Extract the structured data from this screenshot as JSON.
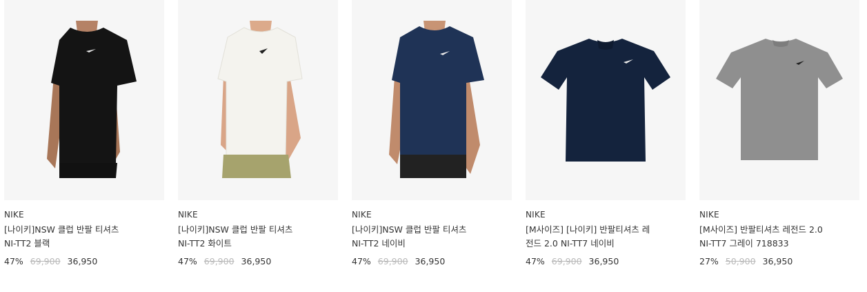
{
  "products": [
    {
      "brand": "NIKE",
      "title_line1": "[나이키]NSW 클럽 반팔 티셔츠",
      "title_line2": "NI-TT2 블랙",
      "discount": "47%",
      "original_price": "69,900",
      "sale_price": "36,950",
      "shirt_color": "#141414",
      "image_type": "model-shirt"
    },
    {
      "brand": "NIKE",
      "title_line1": "[나이키]NSW 클럽 반팔 티셔츠",
      "title_line2": "NI-TT2 화이트",
      "discount": "47%",
      "original_price": "69,900",
      "sale_price": "36,950",
      "shirt_color": "#f4f3ee",
      "image_type": "model-shirt"
    },
    {
      "brand": "NIKE",
      "title_line1": "[나이키]NSW 클럽 반팔 티셔츠",
      "title_line2": "NI-TT2 네이비",
      "discount": "47%",
      "original_price": "69,900",
      "sale_price": "36,950",
      "shirt_color": "#1f3356",
      "image_type": "model-shirt"
    },
    {
      "brand": "NIKE",
      "title_line1": "[M사이즈] [나이키] 반팔티셔츠 레",
      "title_line2": "전드 2.0 NI-TT7 네이비",
      "discount": "47%",
      "original_price": "69,900",
      "sale_price": "36,950",
      "shirt_color": "#14233d",
      "image_type": "flat-shirt"
    },
    {
      "brand": "NIKE",
      "title_line1": "[M사이즈] 반팔티셔츠 레전드 2.0",
      "title_line2": "NI-TT7 그레이 718833",
      "discount": "27%",
      "original_price": "50,900",
      "sale_price": "36,950",
      "shirt_color": "#8f8f8f",
      "image_type": "flat-shirt"
    }
  ]
}
